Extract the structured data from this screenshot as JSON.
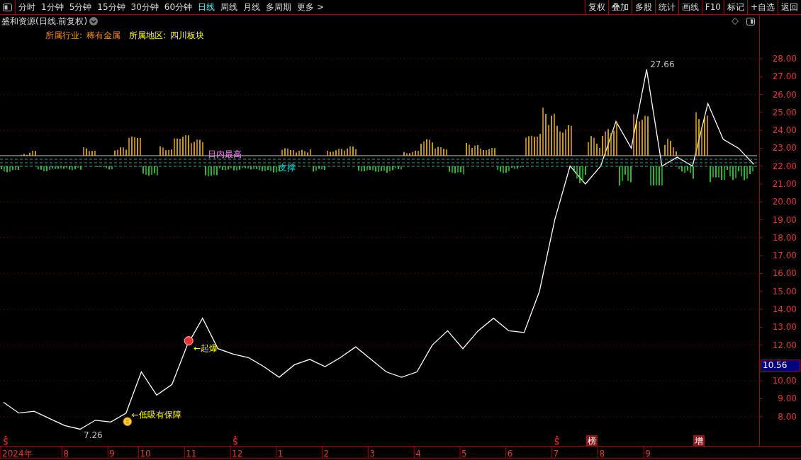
{
  "toolbar": {
    "periods": [
      {
        "label": "分时",
        "selected": false
      },
      {
        "label": "1分钟",
        "selected": false
      },
      {
        "label": "5分钟",
        "selected": false
      },
      {
        "label": "15分钟",
        "selected": false
      },
      {
        "label": "30分钟",
        "selected": false
      },
      {
        "label": "60分钟",
        "selected": false
      },
      {
        "label": "日线",
        "selected": true
      },
      {
        "label": "周线",
        "selected": false
      },
      {
        "label": "月线",
        "selected": false
      },
      {
        "label": "多周期",
        "selected": false
      },
      {
        "label": "更多 >",
        "selected": false
      }
    ],
    "actions": [
      "复权",
      "叠加",
      "多股",
      "统计",
      "画线",
      "F10",
      "标记",
      "+自选",
      "返回"
    ]
  },
  "header": {
    "title": "盛和资源(日线.前复权)",
    "info": [
      {
        "label": "所属行业:",
        "value": "稀有金属"
      },
      {
        "label": "所属地区:",
        "value": "四川板块"
      }
    ]
  },
  "indicator_labels": [
    "日内最高",
    "支撑"
  ],
  "chart_data": {
    "type": "line",
    "grid": true,
    "ylim": [
      6.37,
      30.45
    ],
    "yticks": [
      {
        "value": 8,
        "label": "8.00"
      },
      {
        "value": 9,
        "label": "9.00"
      },
      {
        "value": 10,
        "label": "10.00"
      },
      {
        "value": 12,
        "label": "12.00"
      },
      {
        "value": 13,
        "label": "13.00"
      },
      {
        "value": 14,
        "label": "14.00"
      },
      {
        "value": 15,
        "label": "15.00"
      },
      {
        "value": 16,
        "label": "16.00"
      },
      {
        "value": 17,
        "label": "17.00"
      },
      {
        "value": 18,
        "label": "18.00"
      },
      {
        "value": 19,
        "label": "19.00"
      },
      {
        "value": 20,
        "label": "20.00"
      },
      {
        "value": 21,
        "label": "21.00"
      },
      {
        "value": 22,
        "label": "22.00"
      },
      {
        "value": 23,
        "label": "23.00"
      },
      {
        "value": 24,
        "label": "24.00"
      },
      {
        "value": 25,
        "label": "25.00"
      },
      {
        "value": 26,
        "label": "26.00"
      },
      {
        "value": 27,
        "label": "27.00"
      },
      {
        "value": 28,
        "label": "28.00"
      }
    ],
    "values": [
      8.8,
      8.2,
      8.3,
      7.9,
      7.5,
      7.3,
      7.8,
      7.7,
      8.2,
      10.5,
      9.2,
      9.8,
      12.0,
      13.5,
      11.8,
      11.5,
      11.3,
      10.8,
      10.2,
      10.9,
      11.2,
      10.8,
      11.3,
      11.9,
      11.2,
      10.5,
      10.2,
      10.5,
      12.0,
      12.8,
      11.8,
      12.8,
      13.5,
      12.8,
      12.7,
      15.0,
      19.0,
      22.0,
      21.0,
      22.0,
      24.5,
      23.0,
      27.4,
      22.0,
      22.5,
      22.0,
      25.5,
      23.5,
      23.0,
      22.1
    ]
  },
  "chart_labels": [
    {
      "kind": "low",
      "text": "7.26"
    },
    {
      "kind": "buy",
      "text": "←低吸有保障"
    },
    {
      "kind": "start",
      "text": "←起爆"
    },
    {
      "kind": "high",
      "text": "27.66"
    }
  ],
  "date_axis": [
    "2024年",
    "8",
    "9",
    "10",
    "11",
    "12",
    "1",
    "2",
    "3",
    "4",
    "5",
    "6",
    "7",
    "8",
    "9"
  ],
  "events": [
    {
      "kind": "s"
    },
    {
      "kind": "s"
    },
    {
      "kind": "s"
    },
    {
      "kind": "tag",
      "text": "榜"
    },
    {
      "kind": "tag",
      "text": "增"
    }
  ],
  "last_price": "10.56"
}
